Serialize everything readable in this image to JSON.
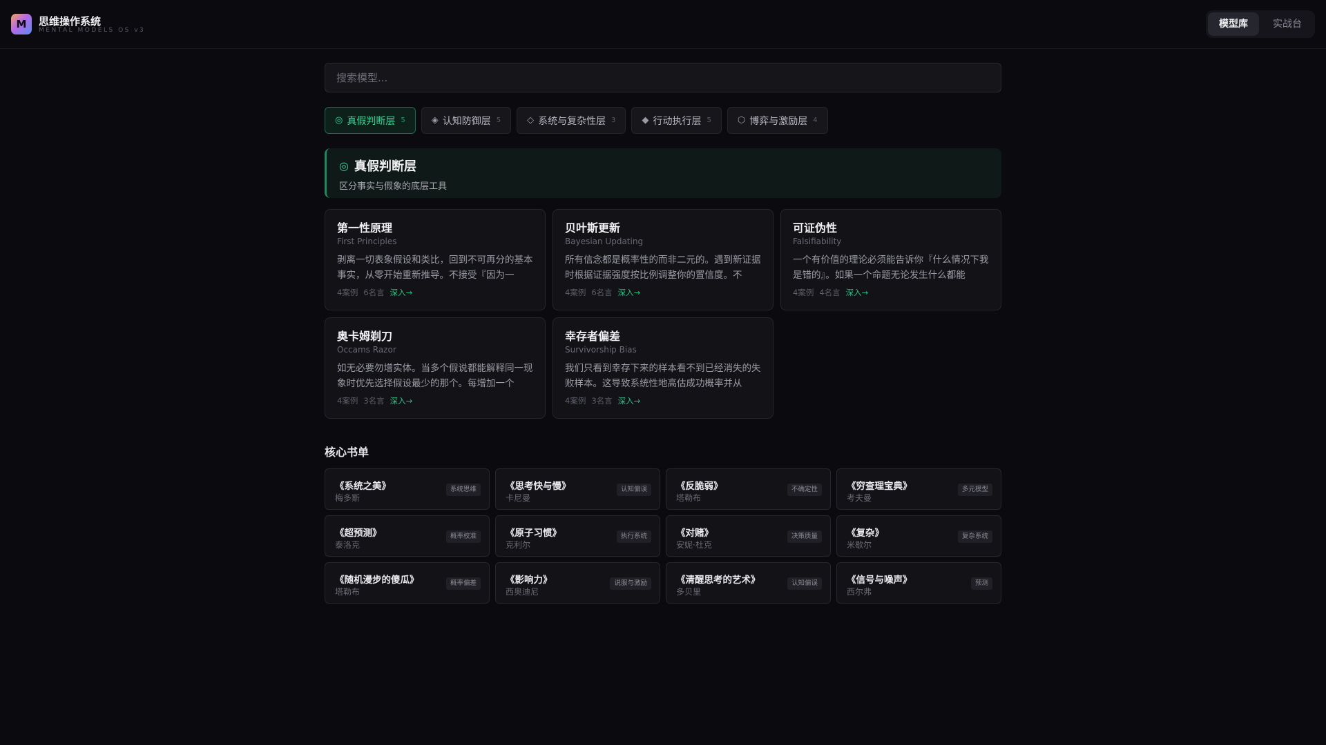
{
  "app": {
    "logo_letter": "M",
    "title": "思维操作系统",
    "subtitle": "MENTAL MODELS OS v3"
  },
  "nav": {
    "items": [
      {
        "label": "模型库",
        "active": true
      },
      {
        "label": "实战台",
        "active": false
      }
    ]
  },
  "search": {
    "placeholder": "搜索模型...",
    "value": ""
  },
  "tabs": [
    {
      "icon": "◎",
      "label": "真假判断层",
      "count": "5",
      "active": true
    },
    {
      "icon": "◈",
      "label": "认知防御层",
      "count": "5",
      "active": false
    },
    {
      "icon": "◇",
      "label": "系统与复杂性层",
      "count": "3",
      "active": false
    },
    {
      "icon": "◆",
      "label": "行动执行层",
      "count": "5",
      "active": false
    },
    {
      "icon": "⬡",
      "label": "博弈与激励层",
      "count": "4",
      "active": false
    }
  ],
  "layer": {
    "icon": "◎",
    "title": "真假判断层",
    "description": "区分事实与假象的底层工具"
  },
  "models": [
    {
      "title": "第一性原理",
      "english": "First Principles",
      "description": "剥离一切表象假设和类比，回到不可再分的基本事实，从零开始重新推导。不接受『因为一",
      "cases": "4案例",
      "quotes": "6名言",
      "more": "深入→"
    },
    {
      "title": "贝叶斯更新",
      "english": "Bayesian Updating",
      "description": "所有信念都是概率性的而非二元的。遇到新证据时根据证据强度按比例调整你的置信度。不",
      "cases": "4案例",
      "quotes": "6名言",
      "more": "深入→"
    },
    {
      "title": "可证伪性",
      "english": "Falsifiability",
      "description": "一个有价值的理论必须能告诉你『什么情况下我是错的』。如果一个命题无论发生什么都能",
      "cases": "4案例",
      "quotes": "4名言",
      "more": "深入→"
    },
    {
      "title": "奥卡姆剃刀",
      "english": "Occams Razor",
      "description": "如无必要勿增实体。当多个假说都能解释同一现象时优先选择假设最少的那个。每增加一个",
      "cases": "4案例",
      "quotes": "3名言",
      "more": "深入→"
    },
    {
      "title": "幸存者偏差",
      "english": "Survivorship Bias",
      "description": "我们只看到幸存下来的样本看不到已经消失的失败样本。这导致系统性地高估成功概率并从",
      "cases": "4案例",
      "quotes": "3名言",
      "more": "深入→"
    }
  ],
  "books_section": {
    "title": "核心书单",
    "books": [
      {
        "title": "《系统之美》",
        "author": "梅多斯",
        "tag": "系统思维"
      },
      {
        "title": "《思考快与慢》",
        "author": "卡尼曼",
        "tag": "认知偏误"
      },
      {
        "title": "《反脆弱》",
        "author": "塔勒布",
        "tag": "不确定性"
      },
      {
        "title": "《穷查理宝典》",
        "author": "考夫曼",
        "tag": "多元模型"
      },
      {
        "title": "《超预测》",
        "author": "泰洛克",
        "tag": "概率校准"
      },
      {
        "title": "《原子习惯》",
        "author": "克利尔",
        "tag": "执行系统"
      },
      {
        "title": "《对赌》",
        "author": "安妮·杜克",
        "tag": "决策质量"
      },
      {
        "title": "《复杂》",
        "author": "米歇尔",
        "tag": "复杂系统"
      },
      {
        "title": "《随机漫步的傻瓜》",
        "author": "塔勒布",
        "tag": "概率偏差"
      },
      {
        "title": "《影响力》",
        "author": "西奥迪尼",
        "tag": "说服与激励"
      },
      {
        "title": "《清醒思考的艺术》",
        "author": "多贝里",
        "tag": "认知偏误"
      },
      {
        "title": "《信号与噪声》",
        "author": "西尔弗",
        "tag": "预测"
      }
    ]
  }
}
